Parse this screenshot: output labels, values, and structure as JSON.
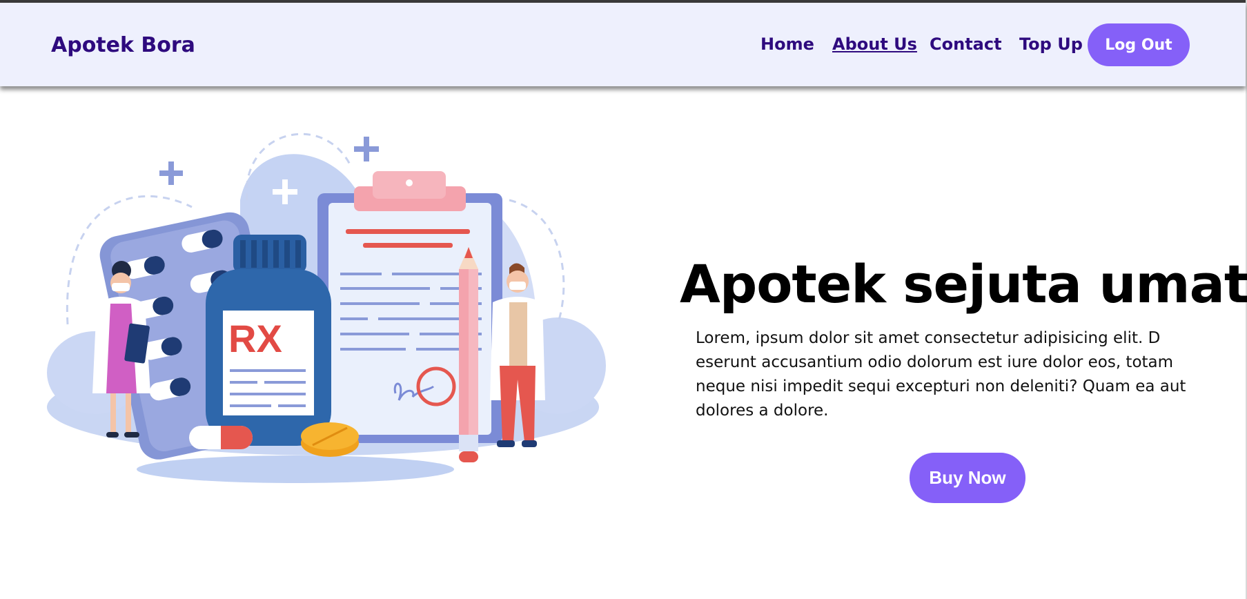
{
  "nav": {
    "brand": "Apotek Bora",
    "links": [
      {
        "label": "Home",
        "active": false
      },
      {
        "label": "About Us",
        "active": true
      },
      {
        "label": "Contact",
        "active": false
      },
      {
        "label": "Top Up",
        "active": false
      }
    ],
    "logout_label": "Log Out"
  },
  "illustration": {
    "rx_label": "RX"
  },
  "hero": {
    "title": "Apotek sejuta umat",
    "text": "Lorem, ipsum dolor sit amet consectetur adipisicing elit. D eserunt accusantium odio dolorum est iure dolor eos, totam neque nisi impedit sequi excepturi non deleniti? Quam ea aut dolores a dolore.",
    "buy_label": "Buy Now"
  },
  "colors": {
    "nav_bg": "#eef0fd",
    "brand_text": "#2e0a7e",
    "accent": "#8560f8"
  }
}
